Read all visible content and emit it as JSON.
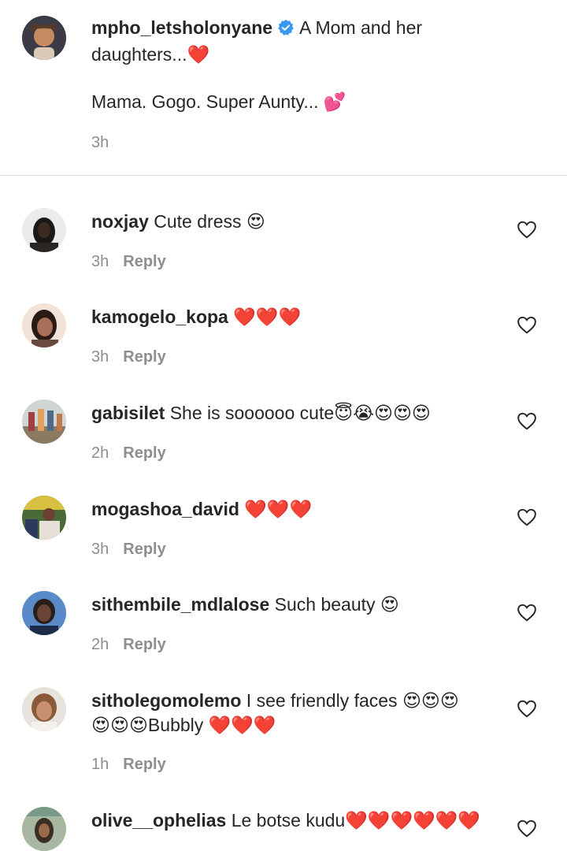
{
  "caption": {
    "username": "mpho_letsholonyane",
    "line1": "A Mom and her",
    "line2": "daughters...❤️",
    "line3": "Mama. Gogo. Super Aunty... 💕",
    "time": "3h"
  },
  "reply_label": "Reply",
  "comments": [
    {
      "username": "noxjay",
      "text": "Cute dress 😍",
      "time": "3h"
    },
    {
      "username": "kamogelo_kopa",
      "text": "❤️❤️❤️",
      "time": "3h"
    },
    {
      "username": "gabisilet",
      "text": "She is soooooo cute😇😭😍😍😍",
      "time": "2h"
    },
    {
      "username": "mogashoa_david",
      "text": "❤️❤️❤️",
      "time": "3h"
    },
    {
      "username": "sithembile_mdlalose",
      "text": "Such beauty 😍",
      "time": "2h"
    },
    {
      "username": "sitholegomolemo",
      "text": "I see friendly faces 😍😍😍",
      "text2": "😍😍😍Bubbly ❤️❤️❤️",
      "time": "1h"
    },
    {
      "username": "olive__ophelias",
      "text": "Le botse kudu❤️❤️❤️❤️❤️❤️"
    }
  ],
  "colors": {
    "verified": "#3897f0",
    "text": "#262626",
    "muted": "#8e8e8e",
    "divider": "#dbdbdb"
  }
}
